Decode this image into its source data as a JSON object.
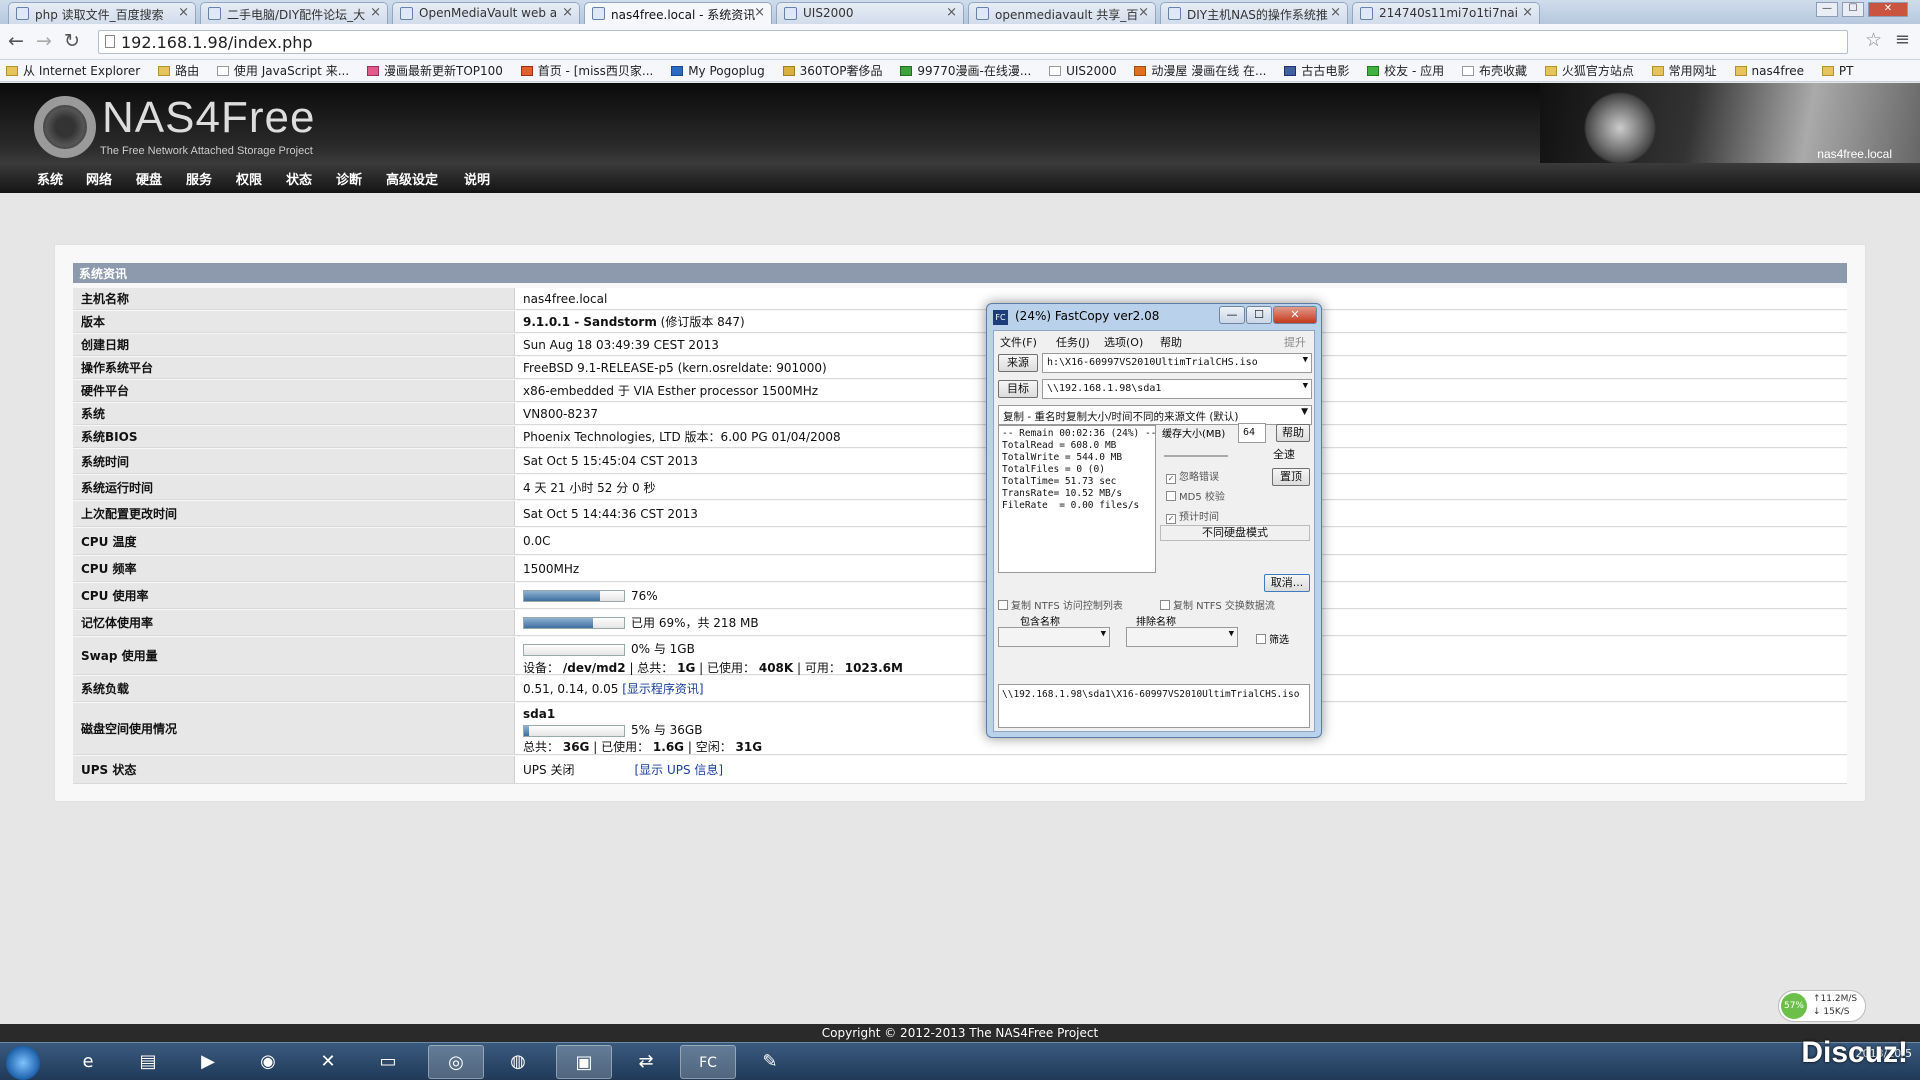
{
  "browser": {
    "tabs": [
      {
        "title": "php 读取文件_百度搜索"
      },
      {
        "title": "二手电脑/DIY配件论坛_大"
      },
      {
        "title": "OpenMediaVault web a"
      },
      {
        "title": "nas4free.local - 系统资讯"
      },
      {
        "title": "UIS2000"
      },
      {
        "title": "openmediavault 共享_百"
      },
      {
        "title": "DIY主机NAS的操作系统推"
      },
      {
        "title": "214740s11mi7o1ti7nai"
      }
    ],
    "close_glyph": "×",
    "url": "192.168.1.98/index.php",
    "bookmarks": [
      "从 Internet Explorer",
      "路由",
      "使用 JavaScript 来...",
      "漫画最新更新TOP100",
      "首页 - [miss西贝家...",
      "My Pogoplug",
      "360TOP奢侈品",
      "99770漫画-在线漫...",
      "UIS2000",
      "动漫屋 漫画在线 在...",
      "古古电影",
      "校友 - 应用",
      "布壳收藏",
      "火狐官方站点",
      "常用网址",
      "nas4free",
      "PT"
    ]
  },
  "nas": {
    "logo": "NAS4Free",
    "logo_sub": "The Free Network Attached Storage Project",
    "hostname_header": "nas4free.local",
    "nav": [
      "系统",
      "网络",
      "硬盘",
      "服务",
      "权限",
      "状态",
      "诊断",
      "高级设定",
      "说明"
    ],
    "section_title": "系统资讯",
    "rows": {
      "hostname": {
        "label": "主机名称",
        "value": "nas4free.local"
      },
      "version": {
        "label": "版本",
        "value_bold": "9.1.0.1 - Sandstorm",
        "value_rest": "(修订版本 847)"
      },
      "build_date": {
        "label": "创建日期",
        "value": "Sun Aug 18 03:49:39 CEST 2013"
      },
      "os": {
        "label": "操作系统平台",
        "value": "FreeBSD 9.1-RELEASE-p5 (kern.osreldate: 901000)"
      },
      "hardware": {
        "label": "硬件平台",
        "value": "x86-embedded 于 VIA Esther processor 1500MHz"
      },
      "system": {
        "label": "系统",
        "value": "VN800-8237"
      },
      "bios": {
        "label": "系统BIOS",
        "value": "Phoenix Technologies, LTD 版本：6.00 PG 01/04/2008"
      },
      "sys_time": {
        "label": "系统时间",
        "value": "Sat Oct  5 15:45:04 CST 2013"
      },
      "uptime": {
        "label": "系统运行时间",
        "value": "4 天 21 小时 52 分 0 秒"
      },
      "last_config": {
        "label": "上次配置更改时间",
        "value": "Sat Oct  5 14:44:36 CST 2013"
      },
      "cpu_temp": {
        "label": "CPU 温度",
        "value": "0.0C"
      },
      "cpu_freq": {
        "label": "CPU 频率",
        "value": "1500MHz"
      },
      "cpu_usage": {
        "label": "CPU 使用率",
        "percent": 76,
        "text": "76%"
      },
      "mem_usage": {
        "label": "记忆体使用率",
        "percent": 69,
        "text": "已用 69%，共 218 MB"
      },
      "swap": {
        "label": "Swap 使用量",
        "percent": 0,
        "text": "0% 与 1GB",
        "d_label": "设备：",
        "d_val": "/dev/md2",
        "t_label": "| 总共：",
        "t_val": "1G",
        "u_label": "| 已使用：",
        "u_val": "408K",
        "f_label": "| 可用：",
        "f_val": "1023.6M"
      },
      "load": {
        "label": "系统负载",
        "value": "0.51, 0.14, 0.05",
        "link": "[显示程序资讯]"
      },
      "disk": {
        "label": "磁盘空间使用情况",
        "name": "sda1",
        "percent": 5,
        "text": "5% 与 36GB",
        "t_label": "总共：",
        "t_val": "36G",
        "u_label": "| 已使用：",
        "u_val": "1.6G",
        "f_label": "| 空闲：",
        "f_val": "31G"
      },
      "ups": {
        "label": "UPS 状态",
        "value": "UPS 关闭",
        "link": "[显示 UPS 信息]"
      }
    },
    "footer": "Copyright © 2012-2013 The NAS4Free Project"
  },
  "fastcopy": {
    "title": "(24%) FastCopy ver2.08",
    "menu": [
      "文件(F)",
      "任务(J)",
      "选项(O)",
      "帮助"
    ],
    "menu_right": "提升",
    "src_btn": "来源",
    "src_val": "h:\\X16-60997VS2010UltimTrialCHS.iso",
    "dst_btn": "目标",
    "dst_val": "\\\\192.168.1.98\\sda1",
    "mode": "复制 - 重名时复制大小/时间不同的来源文件 (默认)",
    "stats": "-- Remain 00:02:36 (24%) --\nTotalRead = 608.0 MB\nTotalWrite = 544.0 MB\nTotalFiles = 0 (0)\nTotalTime= 51.73 sec\nTransRate= 10.52 MB/s\nFileRate  = 0.00 files/s",
    "buffer_label": "缓存大小(MB)",
    "buffer_val": "64",
    "help_btn": "帮助",
    "full_speed": "全速",
    "ignore_err": "忽略错误",
    "top_btn": "置顶",
    "md5": "MD5 校验",
    "estimate": "预计时间",
    "disk_mode": "不同硬盘模式",
    "cancel_btn": "取消...",
    "acl": "复制 NTFS 访问控制列表",
    "ads": "复制 NTFS 交换数据流",
    "include_label": "包含名称",
    "exclude_label": "排除名称",
    "filter": "筛选",
    "log": "\\\\192.168.1.98\\sda1\\X16-60997VS2010UltimTrialCHS.iso",
    "check_glyph": "✓"
  },
  "desktop": {
    "speed_pct": "57%",
    "up": "↑11.2M/S",
    "down": "↓ 15K/S",
    "watermark": "Discuz!",
    "date": "2013/10/5"
  },
  "icons": {
    "back": "←",
    "forward": "→",
    "reload": "↻",
    "star": "☆",
    "menu": "≡",
    "minimize": "—",
    "maximize": "☐",
    "close": "✕"
  }
}
